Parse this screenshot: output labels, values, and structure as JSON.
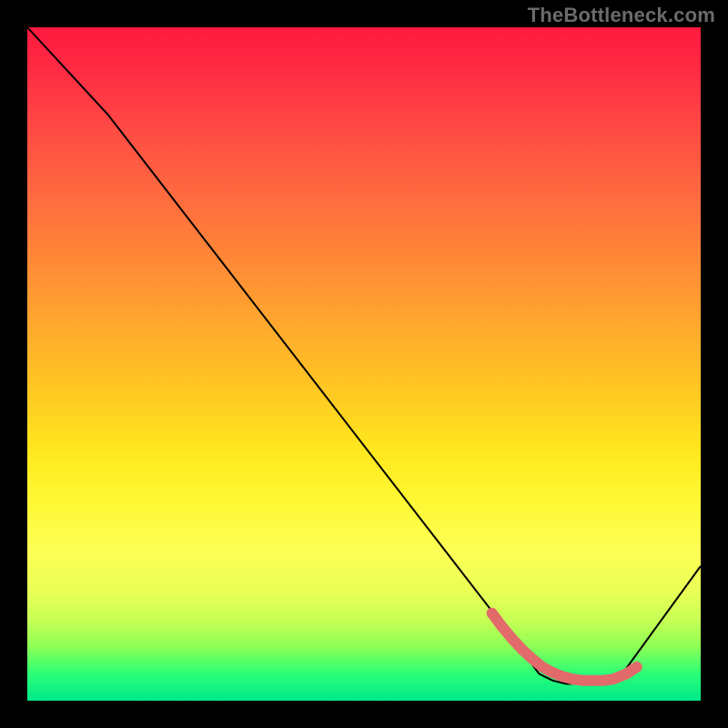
{
  "watermark": "TheBottleneck.com",
  "chart_data": {
    "type": "line",
    "title": "",
    "xlabel": "",
    "ylabel": "",
    "xlim": [
      0,
      100
    ],
    "ylim": [
      0,
      100
    ],
    "series": [
      {
        "name": "curve",
        "x": [
          0,
          12,
          70,
          76,
          78,
          80,
          82,
          84,
          86,
          88,
          100
        ],
        "y": [
          100,
          87,
          12,
          4,
          3,
          2.5,
          2.5,
          2.5,
          3,
          3.5,
          20
        ]
      }
    ],
    "markers": {
      "name": "highlight-band",
      "color": "#e36a6a",
      "points_x": [
        69,
        70.5,
        72,
        73.5,
        75,
        76.5,
        78,
        79.5,
        81,
        82.5,
        84,
        85.5,
        87,
        89,
        90.5
      ],
      "points_y": [
        13,
        11,
        9.2,
        7.6,
        6.2,
        5,
        4.2,
        3.6,
        3.2,
        3,
        3,
        3,
        3.2,
        4,
        5
      ]
    },
    "gradient_stops": [
      {
        "pos": 0.0,
        "color": "#ff1a3e"
      },
      {
        "pos": 0.25,
        "color": "#ff6a3f"
      },
      {
        "pos": 0.55,
        "color": "#ffcb22"
      },
      {
        "pos": 0.78,
        "color": "#fcff55"
      },
      {
        "pos": 1.0,
        "color": "#00e88a"
      }
    ]
  }
}
